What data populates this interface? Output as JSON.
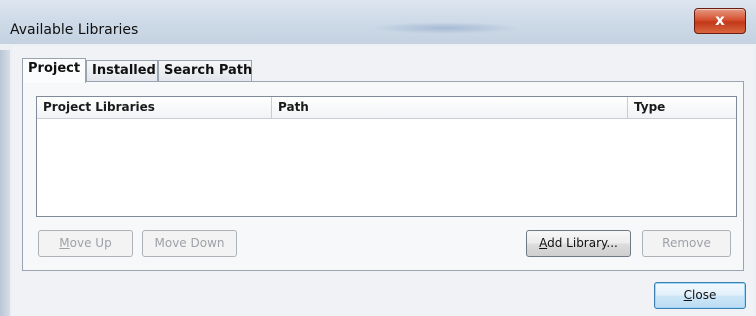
{
  "window": {
    "title": "Available Libraries",
    "close_glyph": "x"
  },
  "tabs": [
    {
      "label": "Project",
      "active": true
    },
    {
      "label": "Installed",
      "active": false
    },
    {
      "label": "Search Path",
      "active": false
    }
  ],
  "table": {
    "columns": [
      "Project Libraries",
      "Path",
      "Type"
    ],
    "rows": []
  },
  "buttons": {
    "move_up": {
      "accel": "M",
      "rest": "ove Up",
      "enabled": false
    },
    "move_down": {
      "accel": "",
      "rest": "Move Down",
      "enabled": false
    },
    "add_library": {
      "accel": "A",
      "rest": "dd Library...",
      "enabled": true
    },
    "remove": {
      "accel": "",
      "rest": "Remove",
      "enabled": false
    },
    "close": {
      "accel": "C",
      "rest": "lose",
      "enabled": true
    }
  },
  "colors": {
    "close_button": "#c2381a",
    "default_button_border": "#3c7fb1",
    "disabled_text": "#9da2a8"
  }
}
